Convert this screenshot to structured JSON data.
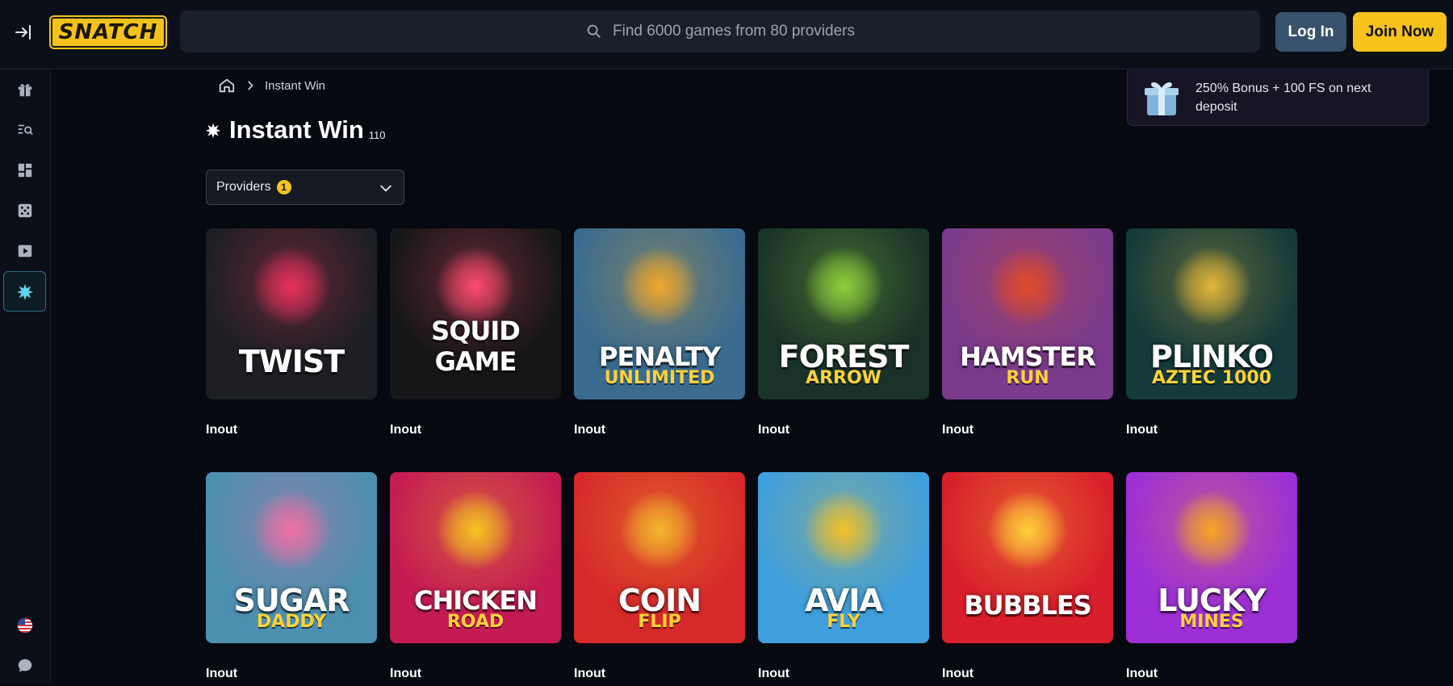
{
  "header": {
    "logo_text": "SNATCH",
    "search_placeholder": "Find 6000 games from 80 providers",
    "login_label": "Log In",
    "join_label": "Join Now"
  },
  "sidebar": {
    "items": [
      {
        "name": "gift-icon"
      },
      {
        "name": "search-list-icon"
      },
      {
        "name": "dashboard-icon"
      },
      {
        "name": "dice-icon"
      },
      {
        "name": "play-icon"
      },
      {
        "name": "instant-win-icon",
        "active": true
      }
    ],
    "bottom": [
      {
        "name": "us-flag-icon"
      },
      {
        "name": "chat-icon"
      }
    ]
  },
  "breadcrumb": {
    "current": "Instant Win"
  },
  "page": {
    "title": "Instant Win",
    "count": "110"
  },
  "filters": {
    "providers_label": "Providers",
    "providers_count": "1"
  },
  "promo": {
    "text": "250% Bonus + 100 FS on next deposit"
  },
  "games": [
    {
      "title": "TWIST",
      "sub": "",
      "provider": "Inout",
      "bg": "#1d1f24",
      "accent": "#e8315b"
    },
    {
      "title": "SQUID GAME",
      "sub": "",
      "provider": "Inout",
      "bg": "#151618",
      "accent": "#ff4b6e"
    },
    {
      "title": "PENALTY",
      "sub": "UNLIMITED",
      "provider": "Inout",
      "bg": "#3a6b8f",
      "accent": "#f0a82a"
    },
    {
      "title": "FOREST",
      "sub": "ARROW",
      "provider": "Inout",
      "bg": "#1a3328",
      "accent": "#8ed13b"
    },
    {
      "title": "HAMSTER",
      "sub": "RUN",
      "provider": "Inout",
      "bg": "#7a3b8c",
      "accent": "#e04a2a"
    },
    {
      "title": "PLINKO",
      "sub": "AZTEC 1000",
      "provider": "Inout",
      "bg": "#143a3a",
      "accent": "#e2b63b"
    },
    {
      "title": "SUGAR",
      "sub": "DADDY",
      "provider": "Inout",
      "bg": "#4d8fb0",
      "accent": "#f06fa4"
    },
    {
      "title": "CHICKEN",
      "sub": "ROAD",
      "provider": "Inout",
      "bg": "#c41c52",
      "accent": "#f5c521"
    },
    {
      "title": "COIN",
      "sub": "FLIP",
      "provider": "Inout",
      "bg": "#d62a2a",
      "accent": "#f3b72c"
    },
    {
      "title": "AVIA",
      "sub": "FLY",
      "provider": "Inout",
      "bg": "#3f9edb",
      "accent": "#f1c02a"
    },
    {
      "title": "BUBBLES",
      "sub": "",
      "provider": "Inout",
      "bg": "#d81f2b",
      "accent": "#ffd13b"
    },
    {
      "title": "LUCKY",
      "sub": "MINES",
      "provider": "Inout",
      "bg": "#9c2fd6",
      "accent": "#f5a623"
    }
  ]
}
